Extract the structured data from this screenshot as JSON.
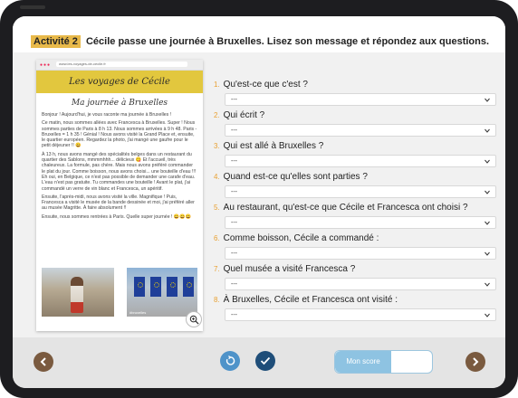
{
  "activity": {
    "tag": "Activité 2",
    "instruction": "Cécile passe une journée à Bruxelles. Lisez son message et répondez aux questions."
  },
  "document": {
    "url": "www.les-voyages-de-cecile.fr",
    "blog_title": "Les voyages de Cécile",
    "post_title": "Ma journée à Bruxelles",
    "paragraphs": [
      "Bonjour ! Aujourd'hui, je vous raconte ma journée à Bruxelles !",
      "Ce matin, nous sommes allées avec Francesca à Bruxelles. Super ! Nous sommes parties de Paris à 8 h 13. Nous sommes arrivées à 9 h 48. Paris - Bruxelles = 1 h 35 ! Génial ! Nous avons visité la Grand Place et, ensuite, le quartier européen. Regardez la photo, j'ai mangé une gaufre pour le petit déjeuner !! 😀",
      "À 13 h, nous avons mangé des spécialités belges dans un restaurant du quartier des Sablons, mmmmhhh... délicieux 😋 Et l'accueil, très chaleureux. La formule, pas chère. Mais nous avons préféré commander le plat du jour. Comme boisson, nous avons choisi... une bouteille d'eau !!! Eh oui, en Belgique, ce n'est pas possible de demander une carafe d'eau. L'eau n'est pas gratuite. Tu commandes une bouteille ! Avant le plat, j'ai commandé un verre de vin blanc et Francesca, un apéritif.",
      "Ensuite, l'après-midi, nous avons visité la ville. Magnifique ! Puis, Francesca a visité le musée de la bande dessinée et moi, j'ai préféré aller au musée Magritte. À faire absolument !!",
      "Ensuite, nous sommes rentrées à Paris. Quelle super journée ! 😀😀😀"
    ],
    "photo_caption": "#bruxelles"
  },
  "questions": [
    {
      "num": "1.",
      "text": "Qu'est-ce que c'est ?",
      "value": "---"
    },
    {
      "num": "2.",
      "text": "Qui écrit ?",
      "value": "---"
    },
    {
      "num": "3.",
      "text": "Qui est allé à Bruxelles ?",
      "value": "---"
    },
    {
      "num": "4.",
      "text": "Quand est-ce qu'elles sont parties ?",
      "value": "---"
    },
    {
      "num": "5.",
      "text": "Au restaurant, qu'est-ce que Cécile et Francesca ont choisi ?",
      "value": "---"
    },
    {
      "num": "6.",
      "text": "Comme boisson, Cécile a commandé :",
      "value": "---"
    },
    {
      "num": "7.",
      "text": "Quel musée a visité Francesca ?",
      "value": "---"
    },
    {
      "num": "8.",
      "text": "À Bruxelles, Cécile et Francesca ont visité :",
      "value": "---"
    }
  ],
  "footer": {
    "score_label": "Mon score"
  },
  "colors": {
    "accent": "#e8a032",
    "tag_bg": "#e8b94a",
    "nav": "#7a5a3f",
    "reset": "#4f93c9",
    "validate": "#1f4e79",
    "toggle": "#8ec3e2"
  },
  "icons": [
    "chevron-down-icon",
    "zoom-in-icon",
    "reset-icon",
    "check-icon",
    "arrow-left-icon",
    "arrow-right-icon"
  ]
}
